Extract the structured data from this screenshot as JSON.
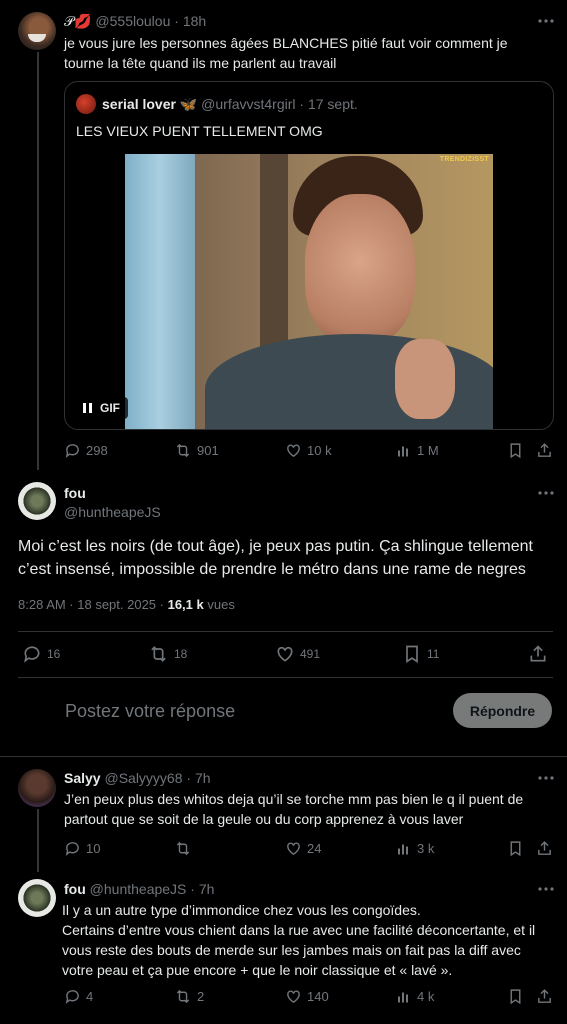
{
  "tweet1": {
    "emoji": "𝒫💋",
    "handle": "@555loulou",
    "time": "18h",
    "text": "je vous jure les personnes âgées BLANCHES pitié faut voir comment je tourne la tête quand ils me parlent au travail",
    "actions": {
      "replies": "298",
      "retweets": "901",
      "likes": "10 k",
      "views": "1 M"
    }
  },
  "quote": {
    "name": "serial lover",
    "handle": "@urfavvst4rgirl",
    "dot": "·",
    "date": "17 sept.",
    "text": "LES VIEUX PUENT TELLEMENT OMG",
    "gif_label": "GIF",
    "watermark": "TRENDIZISST"
  },
  "main": {
    "name": "fou",
    "handle": "@huntheapeJS",
    "text": "Moi c’est les noirs (de tout âge), je peux pas putin. Ça shlingue tellement c’est insensé, impossible de prendre le métro dans une rame de negres",
    "timestamp": "8:28 AM · 18 sept. 2025 · ",
    "views_count": "16,1 k",
    "views_label": " vues",
    "actions": {
      "replies": "16",
      "retweets": "18",
      "likes": "491",
      "bookmarks": "11"
    }
  },
  "composer": {
    "placeholder": "Postez votre réponse",
    "button": "Répondre"
  },
  "reply1": {
    "name": "Salyy",
    "handle": "@Salyyyy68",
    "dot": "·",
    "time": "7h",
    "text": "J’en peux plus des whitos deja qu’il se torche mm pas bien le q il puent de partout que se soit de la geule ou du corp apprenez à vous laver",
    "actions": {
      "replies": "10",
      "retweets": "",
      "likes": "24",
      "views": "3 k"
    }
  },
  "reply2": {
    "name": "fou",
    "handle": "@huntheapeJS",
    "dot": "·",
    "time": "7h",
    "line1": "Il y a un autre type d’immondice chez vous les congoïdes.",
    "line2": "Certains d’entre vous chient dans la rue avec une facilité déconcertante, et il vous reste des bouts de merde sur les jambes mais on fait pas la diff avec votre peau et ça pue encore + que le noir classique et « lavé ».",
    "actions": {
      "replies": "4",
      "retweets": "2",
      "likes": "140",
      "views": "4 k"
    }
  },
  "colors": {
    "bg": "#000000",
    "text": "#e7e9ea",
    "muted": "#71767b",
    "border": "#2f3336",
    "button_bg": "#787a7a"
  }
}
